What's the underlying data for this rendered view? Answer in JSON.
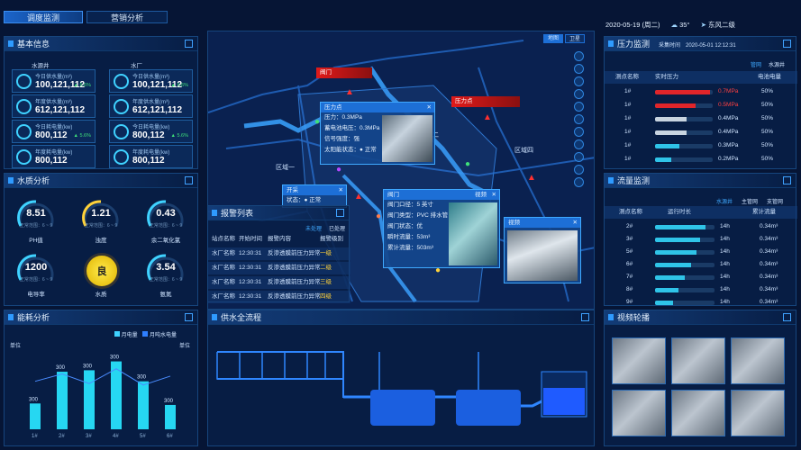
{
  "tabs": [
    "调度监测",
    "营销分析"
  ],
  "header": {
    "date": "2020-05-19 (周二)",
    "temp": "35°",
    "wind": "东风二级"
  },
  "basic": {
    "title": "基本信息",
    "col1": "水源井",
    "col2": "水厂",
    "cards": [
      {
        "label": "今日供水量(m³)",
        "value": "100,121,112",
        "pct": "▲ 5.6%"
      },
      {
        "label": "今日供水量(m³)",
        "value": "100,121,112",
        "pct": "▲ 5.6%"
      },
      {
        "label": "年度供水量(m³)",
        "value": "612,121,112",
        "pct": ""
      },
      {
        "label": "年度供水量(m³)",
        "value": "612,121,112",
        "pct": ""
      },
      {
        "label": "今日耗电量(kw)",
        "value": "800,112",
        "pct": "▲ 5.6%"
      },
      {
        "label": "今日耗电量(kw)",
        "value": "800,112",
        "pct": "▲ 5.6%"
      },
      {
        "label": "年度耗电量(kw)",
        "value": "800,112",
        "pct": ""
      },
      {
        "label": "年度耗电量(kw)",
        "value": "800,112",
        "pct": ""
      }
    ]
  },
  "water": {
    "title": "水质分析",
    "gauges": [
      {
        "v": "8.51",
        "l": "PH值",
        "r": "正常范围：6 ~ 9"
      },
      {
        "v": "1.21",
        "l": "浊度",
        "r": "正常范围：6 ~ 9"
      },
      {
        "v": "0.43",
        "l": "余二氧化氯",
        "r": "正常范围：6 ~ 9"
      },
      {
        "v": "1200",
        "l": "电导率",
        "r": "正常范围：6 ~ 9"
      },
      {
        "v": "良",
        "l": "水质",
        "r": ""
      },
      {
        "v": "3.54",
        "l": "氨氮",
        "r": "正常范围：6 ~ 9"
      }
    ]
  },
  "energy": {
    "title": "能耗分析",
    "legend1": "月电量",
    "legend2": "月吨水电量",
    "unit1": "单位",
    "unit2": "单位"
  },
  "chart_data": {
    "type": "bar",
    "categories": [
      "1#",
      "2#",
      "3#",
      "4#",
      "5#",
      "6#"
    ],
    "values": [
      300,
      300,
      300,
      300,
      300,
      300
    ],
    "bar_fraction": [
      0.35,
      0.78,
      0.8,
      0.92,
      0.65,
      0.33
    ],
    "line_values_relative": [
      0.65,
      0.75,
      0.62,
      0.82,
      0.6,
      0.72
    ]
  },
  "alarm": {
    "title": "报警列表",
    "tab1": "未处理",
    "tab2": "已处理",
    "headers": [
      "站点名称",
      "开始时间",
      "报警内容",
      "报警级别"
    ],
    "rows": [
      [
        "水厂名称",
        "12:30:31",
        "反渗透膜前压力异常",
        "一级"
      ],
      [
        "水厂名称",
        "12:30:31",
        "反渗透膜前压力异常",
        "二级"
      ],
      [
        "水厂名称",
        "12:30:31",
        "反渗透膜前压力异常",
        "三级"
      ],
      [
        "水厂名称",
        "12:30:31",
        "反渗透膜前压力异常",
        "四级"
      ]
    ]
  },
  "map": {
    "btn1": "地图",
    "btn2": "卫星",
    "region1": "区域一",
    "region2": "区域二",
    "region3": "区域三",
    "region4": "区域四",
    "popups": {
      "valve_red": "阀门",
      "pressure_red": "压力点",
      "pressure": {
        "title": "压力点",
        "rows": [
          "压力：0.3MPa",
          "蓄电池电压：0.3MPa",
          "信号强度：强",
          "太阳能状态：● 正常"
        ]
      },
      "well": {
        "title": "开采",
        "rows": [
          "状态：● 正常"
        ]
      },
      "valve": {
        "title": "阀门",
        "tag": "视频",
        "rows": [
          "阀门口径：5 英寸",
          "阀门类型：PVC 排水管",
          "阀门状态：优",
          "瞬时流量：53m³",
          "累计流量：503m³"
        ]
      },
      "video": {
        "title": "视频"
      }
    }
  },
  "flow": {
    "title": "供水全流程"
  },
  "pressure": {
    "title": "压力监测",
    "time": "采集时间　2020-05-01 12:12:31",
    "tab1": "管网",
    "tab2": "水源井",
    "headers": [
      "测点名称",
      "实时压力",
      "电池电量"
    ],
    "rows": [
      [
        "1#",
        "0.7MPa",
        "50%"
      ],
      [
        "1#",
        "0.5MPa",
        "50%"
      ],
      [
        "1#",
        "0.4MPa",
        "50%"
      ],
      [
        "1#",
        "0.4MPa",
        "50%"
      ],
      [
        "1#",
        "0.3MPa",
        "50%"
      ],
      [
        "1#",
        "0.2MPa",
        "50%"
      ]
    ],
    "bar_fraction": [
      0.95,
      0.7,
      0.55,
      0.55,
      0.42,
      0.28
    ]
  },
  "flowmon": {
    "title": "流量监测",
    "tabs": [
      "水源井",
      "主管网",
      "支管网"
    ],
    "headers": [
      "测点名称",
      "运行时长",
      "累计流量"
    ],
    "rows": [
      [
        "2#",
        "14h",
        "0.34m³"
      ],
      [
        "3#",
        "14h",
        "0.34m³"
      ],
      [
        "5#",
        "14h",
        "0.34m³"
      ],
      [
        "6#",
        "14h",
        "0.34m³"
      ],
      [
        "7#",
        "14h",
        "0.34m³"
      ],
      [
        "8#",
        "14h",
        "0.34m³"
      ],
      [
        "9#",
        "14h",
        "0.34m³"
      ]
    ],
    "bar_fraction": [
      0.85,
      0.75,
      0.7,
      0.6,
      0.5,
      0.4,
      0.3
    ]
  },
  "video": {
    "title": "视频轮播"
  }
}
